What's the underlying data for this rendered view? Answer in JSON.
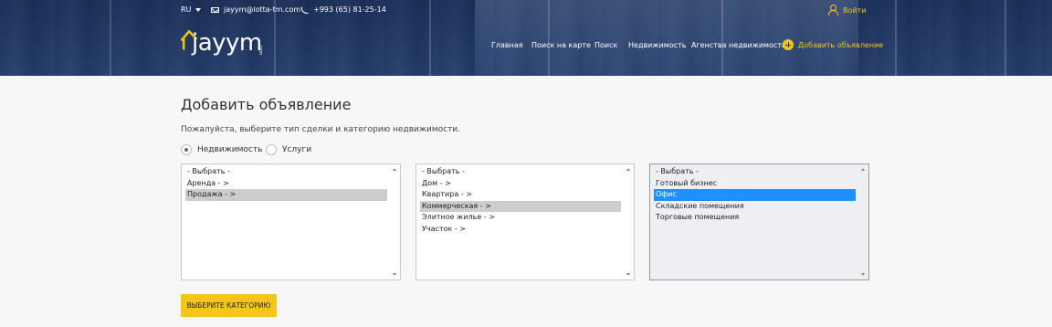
{
  "topbar": {
    "language": "RU",
    "email": "jayym@lotta-tm.com",
    "phone": "+993 (65) 81-25-14",
    "login": "Войти"
  },
  "logo": {
    "text": "jayym",
    "suffix": ".com"
  },
  "nav": {
    "items": [
      "Главная",
      "Поиск на карте",
      "Поиск",
      "Недвижимость",
      "Агенства недвижимости"
    ],
    "add_listing": "Добавить объявление"
  },
  "page": {
    "title": "Добавить объявление",
    "subtitle": "Пожалуйста, выберите тип сделки и категорию недвижимости."
  },
  "radios": [
    {
      "label": "Недвижимость",
      "checked": true
    },
    {
      "label": "Услуги",
      "checked": false
    }
  ],
  "lists": [
    {
      "options": [
        "- Выбрать -",
        "Аренда - >",
        "Продажа - >"
      ],
      "selected": 2
    },
    {
      "options": [
        "- Выбрать -",
        "Дом - >",
        "Квартира - >",
        "Коммерческая - >",
        "Элитное жилье - >",
        "Участок - >"
      ],
      "selected": 3
    },
    {
      "options": [
        "- Выбрать -",
        "Готовый бизнес",
        "Офис",
        "Складские помещения",
        "Торговые помещения"
      ],
      "selected": 2
    }
  ],
  "submit_button": "ВЫБЕРИТЕ КАТЕГОРИЮ",
  "colors": {
    "accent": "#f5c518",
    "header": "#2b3b5e",
    "selection": "#1e90ff"
  },
  "icons": [
    "chevron-down-icon",
    "mail-icon",
    "phone-icon",
    "user-icon",
    "plus-icon",
    "house-icon"
  ]
}
